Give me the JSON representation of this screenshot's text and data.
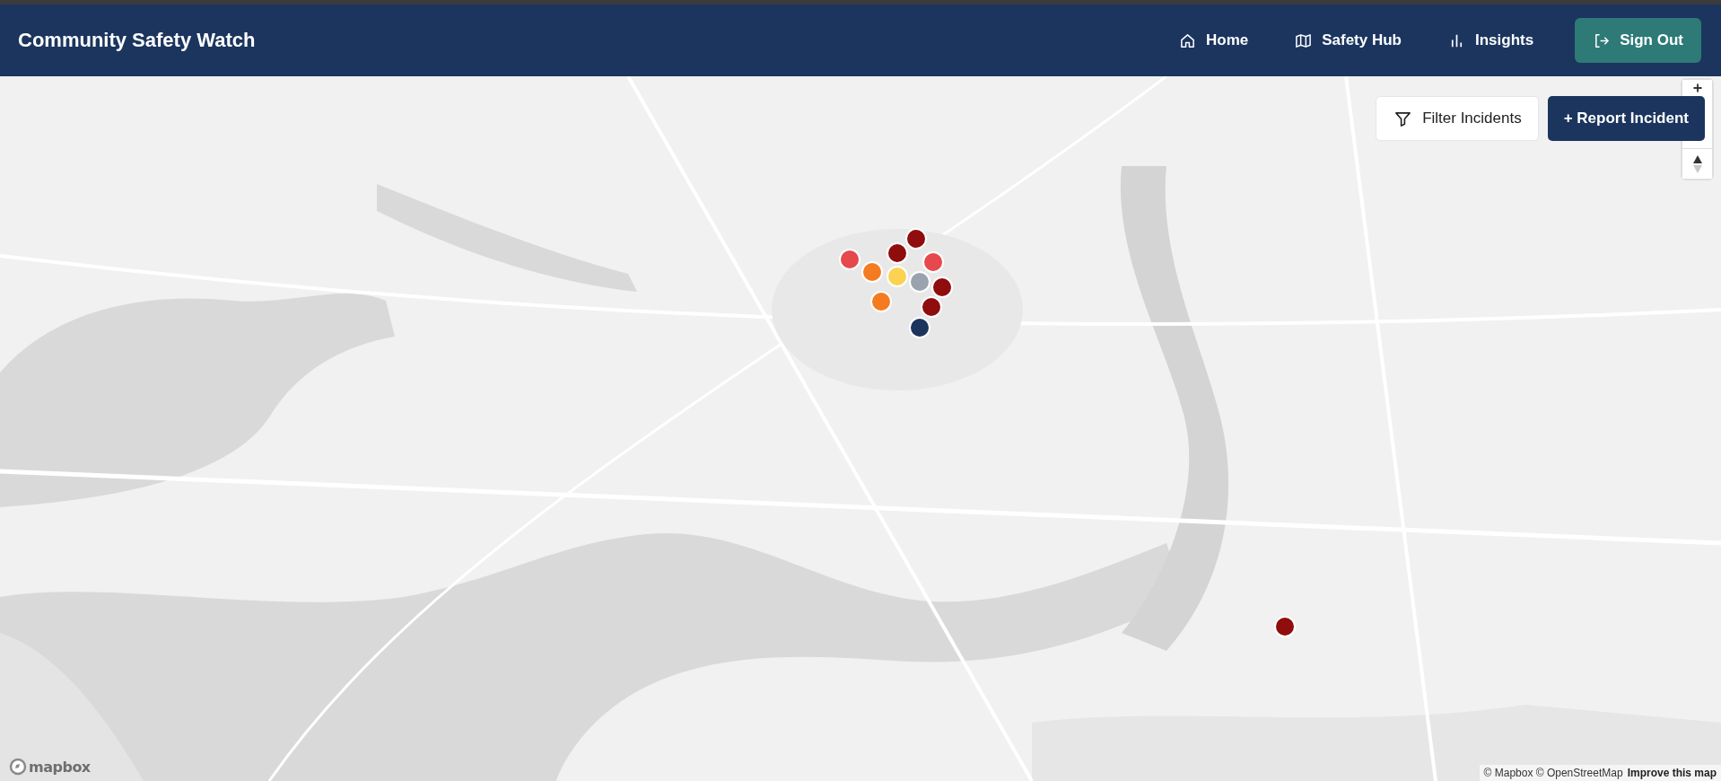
{
  "app_title": "Community Safety Watch",
  "nav": [
    {
      "label": "Home"
    },
    {
      "label": "Safety Hub"
    },
    {
      "label": "Insights"
    }
  ],
  "sign_out": "Sign Out",
  "actions": {
    "filter": "Filter Incidents",
    "report": "+ Report Incident"
  },
  "map": {
    "kind": "picture",
    "incidents": [
      {
        "color": "#8f0d0d"
      },
      {
        "color": "#8f0d0d"
      },
      {
        "color": "#e5484d"
      },
      {
        "color": "#f47b20"
      },
      {
        "color": "#e5484d"
      },
      {
        "color": "#fbd251"
      },
      {
        "color": "#f47b20"
      },
      {
        "color": "#9aa3ad"
      },
      {
        "color": "#8f0d0d"
      },
      {
        "color": "#8f0d0d"
      },
      {
        "color": "#1b355e"
      },
      {
        "color": "#8f0d0d"
      }
    ],
    "logo": "mapbox",
    "attribution": "© Mapbox © OpenStreetMap",
    "improve_link": "Improve this map"
  }
}
